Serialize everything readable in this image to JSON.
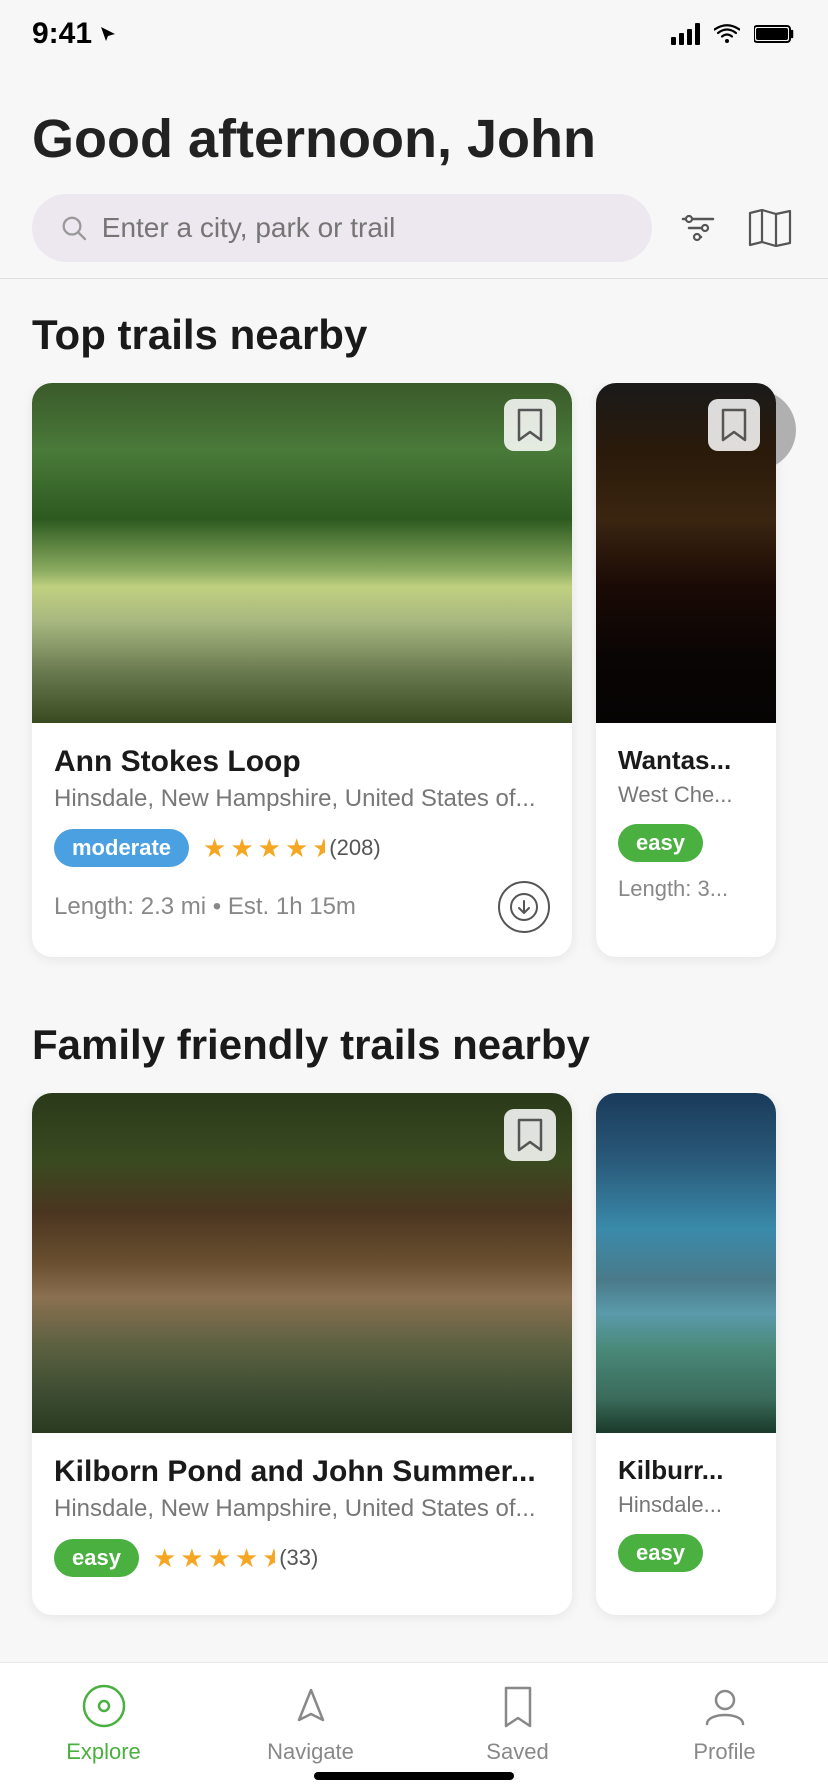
{
  "status_bar": {
    "time": "9:41",
    "location_icon": "arrow-ne"
  },
  "greeting": {
    "text": "Good afternoon, John"
  },
  "search": {
    "placeholder": "Enter a city, park or trail"
  },
  "top_trails_section": {
    "title": "Top trails nearby",
    "trails": [
      {
        "id": "ann-stokes",
        "name": "Ann Stokes Loop",
        "location": "Hinsdale, New Hampshire, United States of...",
        "difficulty": "moderate",
        "rating": 4.5,
        "review_count": "(208)",
        "length": "2.3 mi",
        "est_time": "Est. 1h 15m",
        "image_class": "img-ann-stokes"
      },
      {
        "id": "wantas",
        "name": "Wantas...",
        "location": "West Che...",
        "difficulty": "easy",
        "length": "3...",
        "image_class": "img-wantas",
        "partial": true
      }
    ]
  },
  "family_trails_section": {
    "title": "Family friendly trails nearby",
    "trails": [
      {
        "id": "kilborn-pond",
        "name": "Kilborn Pond and John Summer...",
        "location": "Hinsdale, New Hampshire, United States of...",
        "difficulty": "easy",
        "rating": 4.5,
        "review_count": "(33)",
        "image_class": "img-kilborn"
      },
      {
        "id": "kilburn2",
        "name": "Kilburr...",
        "location": "Hinsdale...",
        "difficulty": "easy",
        "image_class": "img-kilburn2",
        "partial": true
      }
    ]
  },
  "tab_bar": {
    "items": [
      {
        "id": "explore",
        "label": "Explore",
        "active": true
      },
      {
        "id": "navigate",
        "label": "Navigate",
        "active": false
      },
      {
        "id": "saved",
        "label": "Saved",
        "active": false
      },
      {
        "id": "profile",
        "label": "Profile",
        "active": false
      }
    ]
  }
}
